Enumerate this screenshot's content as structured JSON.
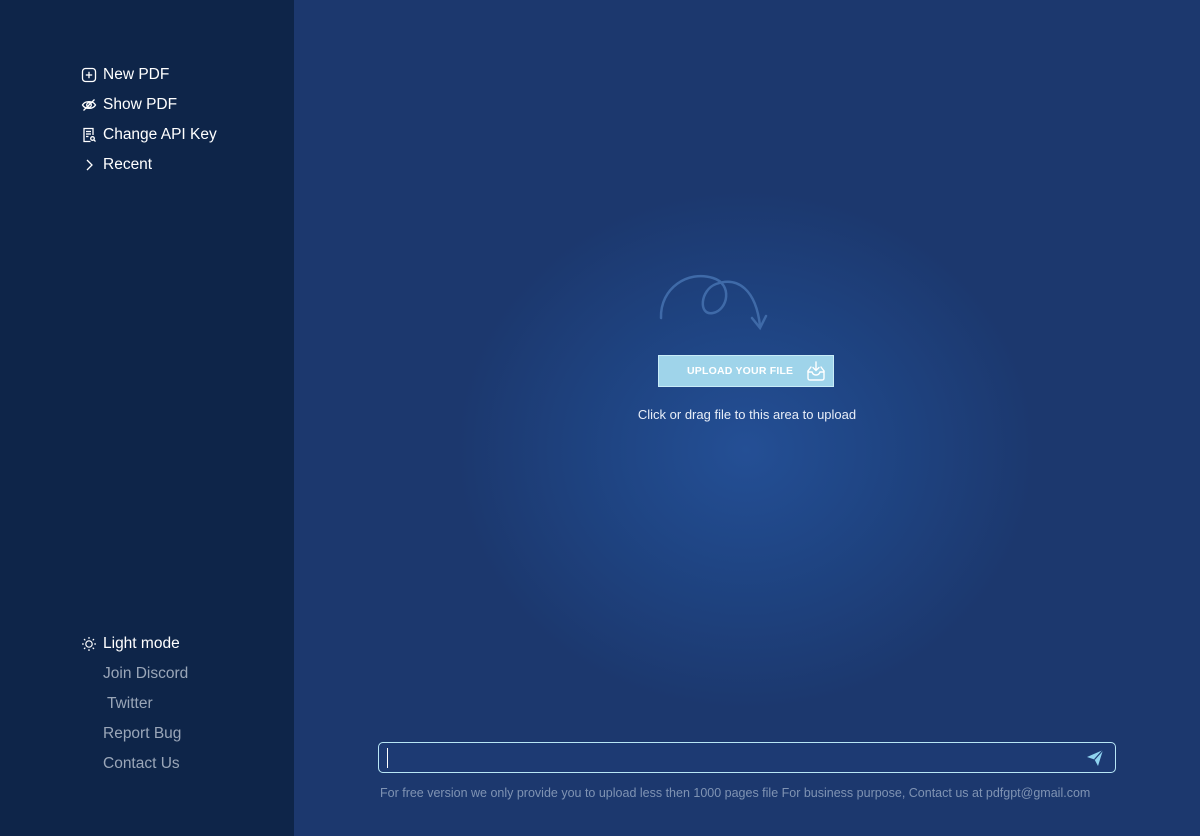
{
  "sidebar": {
    "top_items": [
      {
        "label": "New PDF",
        "icon": "plus-square-icon"
      },
      {
        "label": "Show PDF",
        "icon": "eye-off-icon"
      },
      {
        "label": "Change API Key",
        "icon": "document-search-icon"
      },
      {
        "label": "Recent",
        "icon": "chevron-right-icon"
      }
    ],
    "bottom_items": [
      {
        "label": "Light mode",
        "icon": "sun-icon"
      },
      {
        "label": "Join Discord"
      },
      {
        "label": "Twitter"
      },
      {
        "label": "Report Bug"
      },
      {
        "label": "Contact Us"
      }
    ]
  },
  "upload": {
    "button_label": "UPLOAD YOUR FILE",
    "hint": "Click or drag file to this area to upload"
  },
  "chat": {
    "input_value": "",
    "placeholder": ""
  },
  "footer": {
    "note": "For free version we only provide you to upload less then 1000 pages file For business purpose, Contact us at pdfgpt@gmail.com"
  },
  "colors": {
    "sidebar_bg": "#0e2549",
    "main_bg": "#1c386e",
    "upload_button": "#9fd4ea",
    "input_border": "#b8e6f5"
  }
}
